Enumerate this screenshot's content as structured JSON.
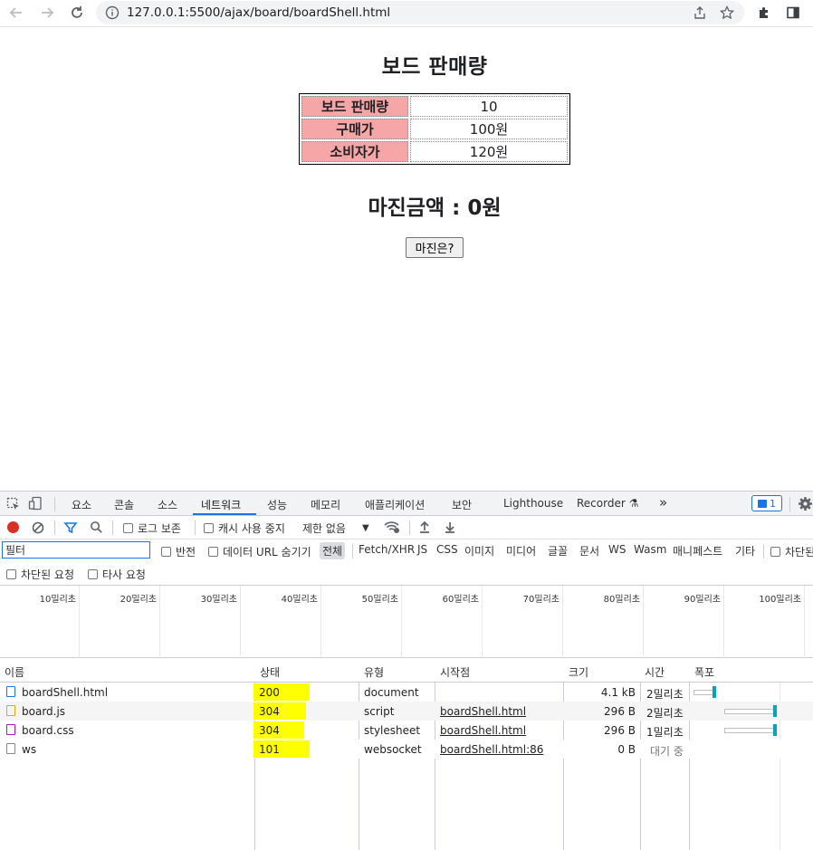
{
  "browser": {
    "url": "127.0.0.1:5500/ajax/board/boardShell.html"
  },
  "page": {
    "title": "보드 판매량",
    "table": [
      {
        "label": "보드 판매량",
        "value": "10"
      },
      {
        "label": "구매가",
        "value": "100원"
      },
      {
        "label": "소비자가",
        "value": "120원"
      }
    ],
    "margin_text": "마진금액 : 0원",
    "margin_button": "마진은?"
  },
  "devtools": {
    "tabs": [
      "요소",
      "콘솔",
      "소스",
      "네트워크",
      "성능",
      "메모리",
      "애플리케이션",
      "보안",
      "Lighthouse",
      "Recorder"
    ],
    "active_tab": "네트워크",
    "more_tabs": "»",
    "issues_count": "1",
    "toolbar": {
      "preserve_log": "로그 보존",
      "disable_cache": "캐시 사용 중지",
      "throttling": "제한 없음"
    },
    "filter": {
      "value": "필터",
      "invert": "반전",
      "hide_data_urls": "데이터 URL 숨기기",
      "types": [
        "전체",
        "Fetch/XHR",
        "JS",
        "CSS",
        "이미지",
        "미디어",
        "글꼴",
        "문서",
        "WS",
        "Wasm",
        "매니페스트",
        "기타"
      ],
      "blocked_cookies": "차단된",
      "blocked_requests": "차단된 요청",
      "third_party": "타사 요청"
    },
    "timeline_ticks": [
      "10밀리초",
      "20밀리초",
      "30밀리초",
      "40밀리초",
      "50밀리초",
      "60밀리초",
      "70밀리초",
      "80밀리초",
      "90밀리초",
      "100밀리초"
    ],
    "columns": [
      "이름",
      "상태",
      "유형",
      "시작점",
      "크기",
      "시간",
      "폭포"
    ],
    "rows": [
      {
        "name": "boardShell.html",
        "status": "200",
        "type": "document",
        "initiator": "",
        "size": "4.1 kB",
        "time": "2밀리초"
      },
      {
        "name": "board.js",
        "status": "304",
        "type": "script",
        "initiator": "boardShell.html",
        "size": "296 B",
        "time": "2밀리초"
      },
      {
        "name": "board.css",
        "status": "304",
        "type": "stylesheet",
        "initiator": "boardShell.html",
        "size": "296 B",
        "time": "1밀리초"
      },
      {
        "name": "ws",
        "status": "101",
        "type": "websocket",
        "initiator": "boardShell.html:86",
        "size": "0 B",
        "time": "대기 중"
      }
    ],
    "colors": {
      "highlight": "#ffff00",
      "accent": "#1a73e8",
      "waterfall": "#00a6b6"
    }
  }
}
